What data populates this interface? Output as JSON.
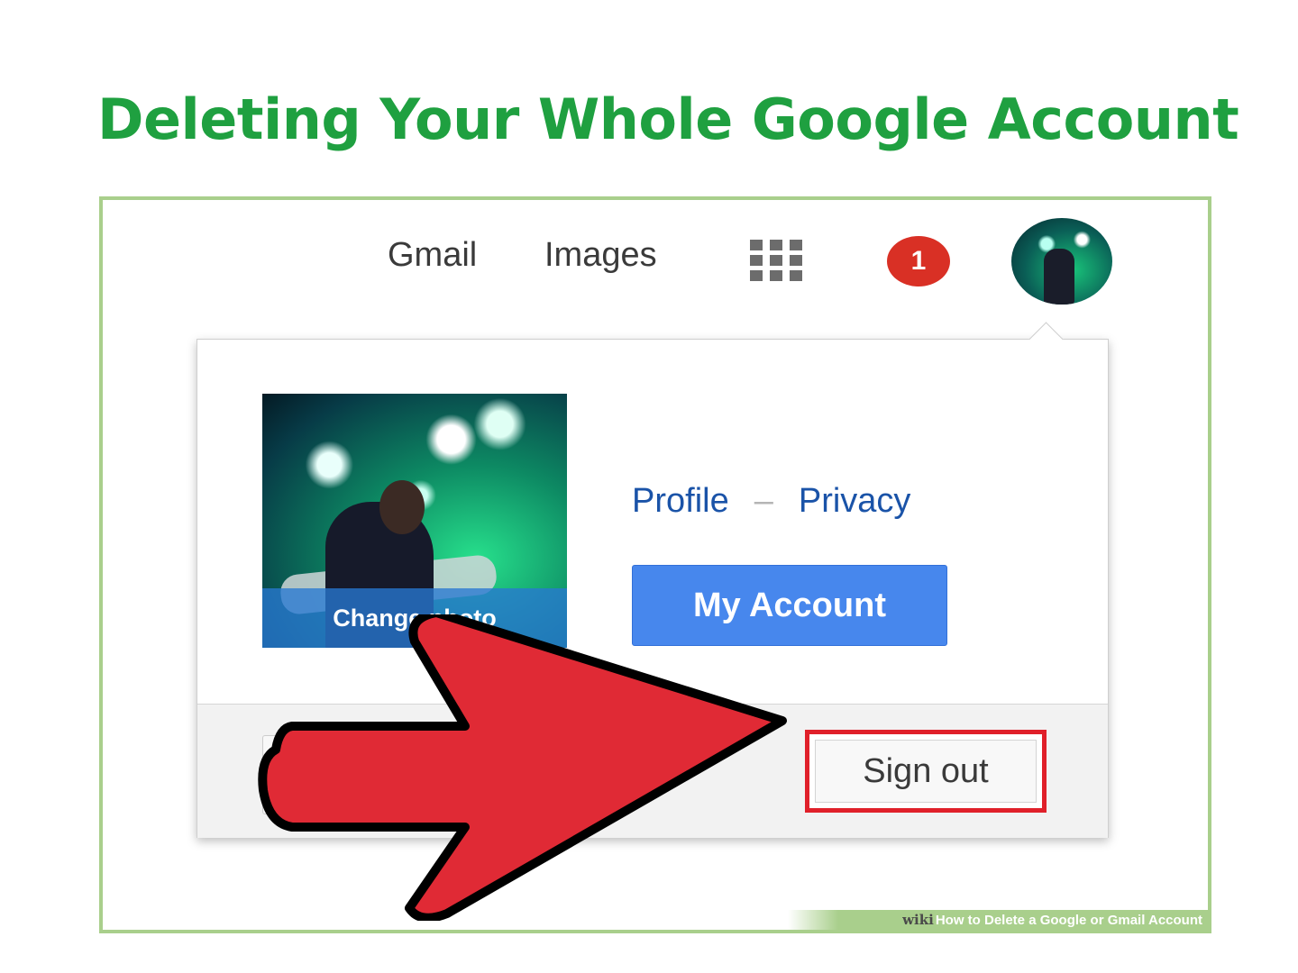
{
  "title": "Deleting Your Whole Google Account",
  "topbar": {
    "gmail_label": "Gmail",
    "images_label": "Images",
    "apps_icon": "apps-grid-icon",
    "notification_count": "1"
  },
  "dropdown": {
    "change_photo_label": "Change photo",
    "profile_link": "Profile",
    "separator": "–",
    "privacy_link": "Privacy",
    "my_account_label": "My Account",
    "sign_out_label": "Sign out"
  },
  "watermark": {
    "logo": "wiki",
    "text": "How to Delete a Google or Gmail Account"
  },
  "colors": {
    "title_green": "#1fa040",
    "frame_border": "#a9cf8c",
    "link_blue": "#1a53a8",
    "button_blue": "#4787ed",
    "badge_red": "#d93025",
    "highlight_red": "#e0202a",
    "arrow_red": "#e02a35"
  }
}
